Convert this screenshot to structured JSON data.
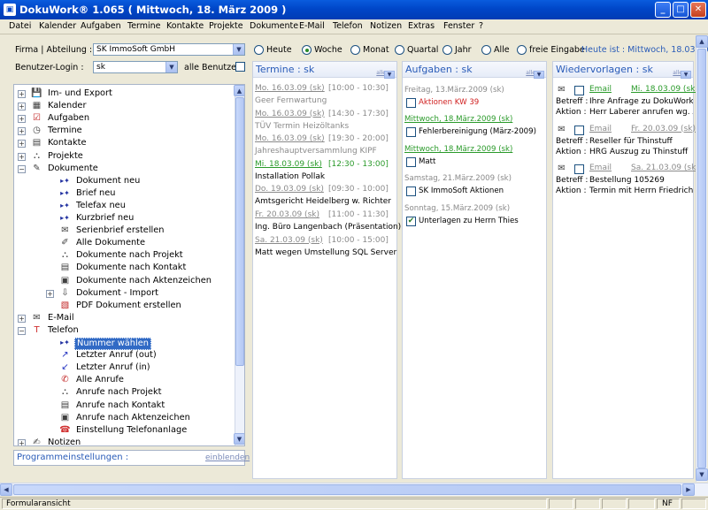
{
  "window": {
    "title": "DokuWork® 1.065 ( Mittwoch, 18. März 2009 )",
    "minimize": "_",
    "maximize": "□",
    "close": "✕"
  },
  "menu": [
    "Datei",
    "Kalender",
    "Aufgaben",
    "Termine",
    "Kontakte",
    "Projekte",
    "Dokumente",
    "E-Mail",
    "Telefon",
    "Notizen",
    "Extras",
    "Fenster",
    "?"
  ],
  "filter": {
    "firma_label": "Firma | Abteilung :",
    "firma_value": "SK ImmoSoft GmbH",
    "login_label": "Benutzer-Login :",
    "login_value": "sk",
    "alle_benutzer": "alle Benutzer :"
  },
  "periods": {
    "options": [
      "Heute",
      "Woche",
      "Monat",
      "Quartal",
      "Jahr",
      "Alle",
      "freie Eingabe"
    ],
    "selected": "Woche",
    "today": "Heute ist : Mittwoch, 18.03.2009"
  },
  "tree": [
    {
      "label": "Im- und Export",
      "icon": "save-icon",
      "level": 0,
      "exp": "+"
    },
    {
      "label": "Kalender",
      "icon": "calendar-icon",
      "level": 0,
      "exp": "+"
    },
    {
      "label": "Aufgaben",
      "icon": "checklist-icon",
      "level": 0,
      "exp": "+"
    },
    {
      "label": "Termine",
      "icon": "clock-icon",
      "level": 0,
      "exp": "+"
    },
    {
      "label": "Kontakte",
      "icon": "contact-card-icon",
      "level": 0,
      "exp": "+"
    },
    {
      "label": "Projekte",
      "icon": "project-icon",
      "level": 0,
      "exp": "+"
    },
    {
      "label": "Dokumente",
      "icon": "document-edit-icon",
      "level": 0,
      "exp": "−"
    },
    {
      "label": "Dokument neu",
      "icon": "arrow-star-icon",
      "level": 1
    },
    {
      "label": "Brief neu",
      "icon": "arrow-star-icon",
      "level": 1
    },
    {
      "label": "Telefax neu",
      "icon": "arrow-star-icon",
      "level": 1
    },
    {
      "label": "Kurzbrief neu",
      "icon": "arrow-star-icon",
      "level": 1
    },
    {
      "label": "Serienbrief erstellen",
      "icon": "mail-merge-icon",
      "level": 1
    },
    {
      "label": "Alle Dokumente",
      "icon": "pencil-icon",
      "level": 1
    },
    {
      "label": "Dokumente nach Projekt",
      "icon": "project-icon",
      "level": 1
    },
    {
      "label": "Dokumente nach Kontakt",
      "icon": "contact-card-icon",
      "level": 1
    },
    {
      "label": "Dokumente nach Aktenzeichen",
      "icon": "folder-key-icon",
      "level": 1
    },
    {
      "label": "Dokument - Import",
      "icon": "import-icon",
      "level": 1,
      "exp": "+"
    },
    {
      "label": "PDF Dokument erstellen",
      "icon": "pdf-icon",
      "level": 1
    },
    {
      "label": "E-Mail",
      "icon": "mail-icon",
      "level": 0,
      "exp": "+"
    },
    {
      "label": "Telefon",
      "icon": "phone-t-icon",
      "level": 0,
      "exp": "−"
    },
    {
      "label": "Nummer wählen",
      "icon": "arrow-star-icon",
      "level": 1,
      "selected": true
    },
    {
      "label": "Letzter Anruf (out)",
      "icon": "call-out-icon",
      "level": 1
    },
    {
      "label": "Letzter Anruf (in)",
      "icon": "call-in-icon",
      "level": 1
    },
    {
      "label": "Alle Anrufe",
      "icon": "call-all-icon",
      "level": 1
    },
    {
      "label": "Anrufe nach Projekt",
      "icon": "project-icon",
      "level": 1
    },
    {
      "label": "Anrufe nach Kontakt",
      "icon": "contact-card-icon",
      "level": 1
    },
    {
      "label": "Anrufe nach Aktenzeichen",
      "icon": "folder-key-icon",
      "level": 1
    },
    {
      "label": "Einstellung Telefonanlage",
      "icon": "telephone-icon",
      "level": 1
    },
    {
      "label": "Notizen",
      "icon": "note-icon",
      "level": 0,
      "exp": "+"
    }
  ],
  "settings": {
    "label": "Programmeinstellungen :",
    "action": "einblenden"
  },
  "termine": {
    "title": "Termine : sk",
    "alle": "alle",
    "items": [
      {
        "date": "Mo. 16.03.09 (sk)",
        "time": "[10:00 - 10:30]",
        "text": "Geer Fernwartung",
        "state": "past"
      },
      {
        "date": "Mo. 16.03.09 (sk)",
        "time": "[14:30 - 17:30]",
        "text": "TÜV Termin Heizöltanks",
        "state": "past"
      },
      {
        "date": "Mo. 16.03.09 (sk)",
        "time": "[19:30 - 20:00]",
        "text": "Jahreshauptversammlung KIPF",
        "state": "past"
      },
      {
        "date": "Mi. 18.03.09 (sk)",
        "time": "[12:30 - 13:00]",
        "text": "Installation Pollak",
        "state": "today"
      },
      {
        "date": "Do. 19.03.09 (sk)",
        "time": "[09:30 - 10:00]",
        "text": "Amtsgericht Heidelberg w. Richter",
        "state": "future"
      },
      {
        "date": "Fr. 20.03.09 (sk)",
        "time": "[11:00 - 11:30]",
        "text": "Ing. Büro Langenbach (Präsentation)",
        "state": "future"
      },
      {
        "date": "Sa. 21.03.09 (sk)",
        "time": "[10:00 - 15:00]",
        "text": "Matt wegen Umstellung SQL Server",
        "state": "future"
      }
    ]
  },
  "aufgaben": {
    "title": "Aufgaben : sk",
    "alle": "alle",
    "items": [
      {
        "date": "Freitag, 13.März.2009 (sk)",
        "text": "Aktionen KW 39",
        "state": "overdue",
        "checked": false
      },
      {
        "date": "Mittwoch, 18.März.2009 (sk)",
        "text": "Fehlerbereinigung (März-2009)",
        "state": "today",
        "checked": false
      },
      {
        "date": "Mittwoch, 18.März.2009 (sk)",
        "text": "Matt",
        "state": "today",
        "checked": false
      },
      {
        "date": "Samstag, 21.März.2009 (sk)",
        "text": "SK ImmoSoft Aktionen",
        "state": "future",
        "checked": false
      },
      {
        "date": "Sonntag, 15.März.2009 (sk)",
        "text": "Unterlagen zu Herrn Thies",
        "state": "done",
        "checked": true
      }
    ]
  },
  "wiedervorlagen": {
    "title": "Wiedervorlagen : sk",
    "alle": "alle",
    "betreff_label": "Betreff :",
    "aktion_label": "Aktion :",
    "items": [
      {
        "type": "Email",
        "date": "Mi. 18.03.09 (sk)",
        "betreff": "Ihre Anfrage zu DokuWork üb",
        "aktion": "Herr Laberer anrufen wg. Al-S",
        "state": "today"
      },
      {
        "type": "Email",
        "date": "Fr. 20.03.09 (sk)",
        "betreff": "Reseller für Thinstuff",
        "aktion": "HRG Auszug zu Thinstuff",
        "state": "future"
      },
      {
        "type": "Email",
        "date": "Sa. 21.03.09 (sk)",
        "betreff": "Bestellung 105269",
        "aktion": "Termin mit Herrn Friedrichs zu",
        "state": "future"
      }
    ]
  },
  "status": {
    "text": "Formularansicht",
    "nf": "NF"
  },
  "colors": {
    "accent": "#2a5cb8",
    "today": "#2a9a2a",
    "overdue": "#d02020",
    "past": "#8a8a8a",
    "selection": "#316ac5"
  }
}
